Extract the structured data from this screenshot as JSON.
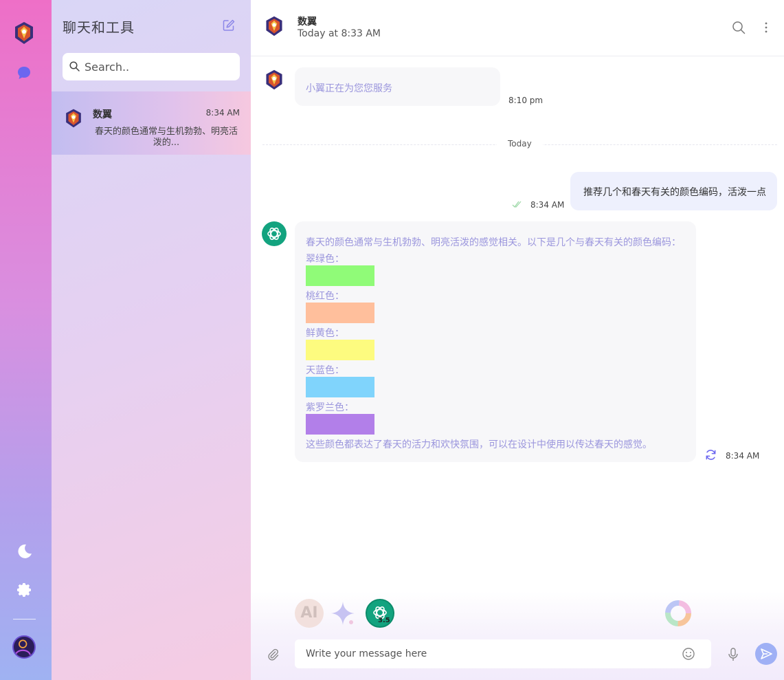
{
  "colors": {
    "rail_top": "#ee6fc7",
    "rail_bottom": "#9fb2f2",
    "assistant_text": "#9b96dd",
    "user_bubble": "#eef0fd",
    "gpt_green": "#13a37f",
    "send_button": "#9fb0f5"
  },
  "rail": {
    "icons": [
      "app-logo-icon",
      "chat-icon",
      "moon-icon",
      "gear-icon",
      "avatar-icon"
    ]
  },
  "sidebar": {
    "title": "聊天和工具",
    "compose_icon": "edit-icon",
    "search": {
      "placeholder": "Search.."
    },
    "conversations": [
      {
        "name": "数翼",
        "time": "8:34 AM",
        "preview": "春天的颜色通常与生机勃勃、明亮活泼的..."
      }
    ]
  },
  "header": {
    "name": "数翼",
    "status": "Today at 8:33 AM",
    "icons": [
      "search-icon",
      "more-vertical-icon"
    ]
  },
  "messages": [
    {
      "role": "bot",
      "text": "小翼正在为您您服务",
      "time": "8:10 pm"
    },
    {
      "role": "divider",
      "label": "Today"
    },
    {
      "role": "user",
      "text": "推荐几个和春天有关的颜色编码，活泼一点",
      "time": "8:34 AM"
    },
    {
      "role": "assistant",
      "intro": "春天的颜色通常与生机勃勃、明亮活泼的感觉相关。以下是几个与春天有关的颜色编码：",
      "colors": [
        {
          "label": "翠绿色：",
          "hex": "#90fb78"
        },
        {
          "label": "桃红色：",
          "hex": "#ffbf9c"
        },
        {
          "label": "鲜黄色：",
          "hex": "#fdfb7f"
        },
        {
          "label": "天蓝色：",
          "hex": "#80d4fc"
        },
        {
          "label": "紫罗兰色：",
          "hex": "#b27fe9"
        }
      ],
      "outro": "这些颜色都表达了春天的活力和欢快氛围，可以在设计中使用以传达春天的感觉。",
      "time": "8:34 AM"
    }
  ],
  "models": [
    {
      "name": "claude-model-icon",
      "mark": "AI"
    },
    {
      "name": "gemini-model-icon"
    },
    {
      "name": "chatgpt-model-icon",
      "version": "3.5"
    },
    {
      "name": "color-ring-icon"
    }
  ],
  "composer": {
    "placeholder": "Write your message here",
    "icons": [
      "paperclip-icon",
      "emoji-icon",
      "microphone-icon",
      "send-icon"
    ]
  }
}
